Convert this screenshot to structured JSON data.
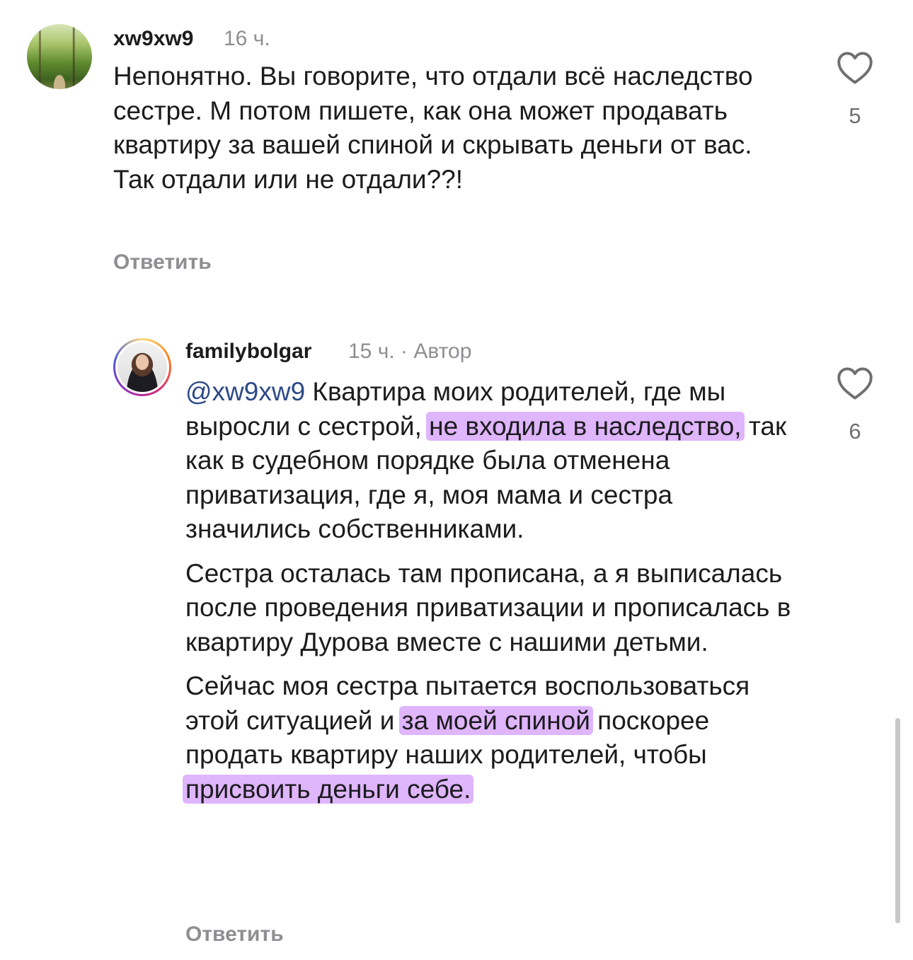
{
  "comments": [
    {
      "username": "xw9xw9",
      "time": "16 ч.",
      "text": "Непонятно. Вы говорите, что отдали всё наследство сестре. М потом пишете, как она может продавать квартиру за вашей спиной и скрывать деньги от вас. Так отдали или не отдали??!",
      "likes": "5",
      "reply_label": "Ответить"
    },
    {
      "username": "familybolgar",
      "time": "15 ч.",
      "separator": "·",
      "author_badge": "Автор",
      "mention": "@xw9xw9",
      "p1_a": " Квартира моих родителей, где мы выросли с сестрой, ",
      "p1_hl": "не входила в наследство,",
      "p1_b": " так как в судебном порядке была отменена приватизация, где я, моя мама и сестра значились собственниками.",
      "p2": "Сестра осталась там прописана, а я выписалась после проведения приватизации и прописалась в квартиру Дурова вместе с нашими детьми.",
      "p3_a": "Сейчас моя сестра пытается воспользоваться этой ситуацией и ",
      "p3_hl1": "за моей спиной",
      "p3_b": " поскорее продать квартиру наших родителей, чтобы ",
      "p3_hl2": "присвоить деньги себе.",
      "likes": "6",
      "reply_label": "Ответить"
    }
  ],
  "icons": {
    "avatar_1": "forest-avatar",
    "avatar_2": "person-avatar",
    "like": "heart-outline-icon"
  },
  "colors": {
    "highlight": "#c478fa",
    "mention": "#2d4a86",
    "meta": "#8e8e93"
  }
}
